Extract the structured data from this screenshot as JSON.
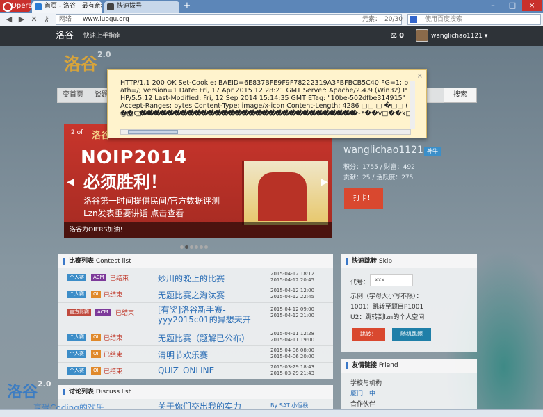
{
  "browser": {
    "menu_label": "Opera",
    "tabs": [
      {
        "label": "首页 - 洛谷 | 最有亲和..."
      },
      {
        "label": "快速拨号"
      }
    ],
    "address_prefix": "网络",
    "url": "www.luogu.org",
    "elements_label": "元素：",
    "elements_count": "20/30",
    "search_placeholder": "使用百度搜索"
  },
  "site_header": {
    "brand": "洛谷",
    "guide": "快速上手指南",
    "gift_count": "0",
    "username": "wanglichao1121"
  },
  "logo": {
    "text": "洛谷",
    "version": "2.0"
  },
  "nav": {
    "items": [
      "变首页",
      "谈题"
    ],
    "search_label": "搜索"
  },
  "banner": {
    "index": "2 of",
    "logo": "洛谷",
    "title1": "NOIP2014",
    "title2": "必须胜利！",
    "line1": "洛谷第一时间提供民间/官方数据评测",
    "line2": "Lzn发表重要讲话 点击查看",
    "caption": "洛谷为OIERS加油！"
  },
  "user_panel": {
    "name": "wanglichao1121",
    "badge": "神牛",
    "score_line": "积分：1755 / 财富：492",
    "contrib_line": "贡献：25 / 活跃度：275",
    "checkin": "打卡！"
  },
  "contest_list": {
    "title": "比赛列表",
    "subtitle": "Contest list",
    "rows": [
      {
        "type": "个人赛",
        "format": "ACM",
        "status": "已结束",
        "name": "炒川的晚上的比赛",
        "start": "2015-04-12 18:12",
        "end": "2015-04-12 20:45"
      },
      {
        "type": "个人赛",
        "format": "OI",
        "status": "已结束",
        "name": "无题比赛之淘汰赛",
        "start": "2015-04-12 12:00",
        "end": "2015-04-12 22:45"
      },
      {
        "type": "官方比赛",
        "format": "ACM",
        "status": "已结束",
        "name": "[有奖]洛谷新手赛-yyy2015c01的异想天开",
        "start": "2015-04-12 09:00",
        "end": "2015-04-12 21:00"
      },
      {
        "type": "个人赛",
        "format": "OI",
        "status": "已结束",
        "name": "无题比赛（题解已公布）",
        "start": "2015-04-11 12:28",
        "end": "2015-04-11 19:00"
      },
      {
        "type": "个人赛",
        "format": "OI",
        "status": "已结束",
        "name": "清明节欢乐赛",
        "start": "2015-04-06 08:00",
        "end": "2015-04-06 20:00"
      },
      {
        "type": "个人赛",
        "format": "OI",
        "status": "已结束",
        "name": "QUIZ_ONLINE",
        "start": "2015-03-29 18:43",
        "end": "2015-03-29 21:43"
      }
    ]
  },
  "discuss_list": {
    "title": "讨论列表",
    "subtitle": "Discuss list",
    "first_item": "关于你们交出我的实力",
    "first_by": "By SAT 小恒栈"
  },
  "skip_panel": {
    "title": "快速跳转",
    "subtitle": "Skip",
    "code_label": "代号：",
    "code_placeholder": "xxx",
    "hint1": "示例（字母大小写不限）：",
    "hint2": "1001：跳转至题目P1001",
    "hint3": "U2：跳转到lzn的个人空间",
    "jump_btn": "跳转！",
    "random_btn": "随机跳题"
  },
  "friend_panel": {
    "title": "友情链接",
    "subtitle": "Friend",
    "links": [
      "学校与机构",
      "厦门一中",
      "合作伙伴"
    ]
  },
  "watermark": {
    "text": "洛谷",
    "version": "2.0",
    "slogan": "享受Coding的欢乐"
  },
  "popup": {
    "text": "HTTP/1.1 200 OK Set-Cookie: BAEID=6E837BFE9F9F78222319A3FBFBCB5C40:FG=1; path=/; version=1 Date: Fri, 17 Apr 2015 12:28:21 GMT Server: Apache/2.4.9 (Win32) PHP/5.5.12 Last-Modified: Fri, 12 Sep 2014 15:14:35 GMT ETag: \"10be-502dfbe314915\" Accept-Ranges: bytes Content-Type: image/x-icon Content-Length: 4286 □□ □ �□□ ( @□ □��������������������������������",
    "garbage": "��G��������������������������������~*��v□��x□��x□����x□�"
  },
  "colors": {
    "accent": "#3b78c8",
    "checkin": "#d9482f",
    "ended": "#c0392b"
  }
}
